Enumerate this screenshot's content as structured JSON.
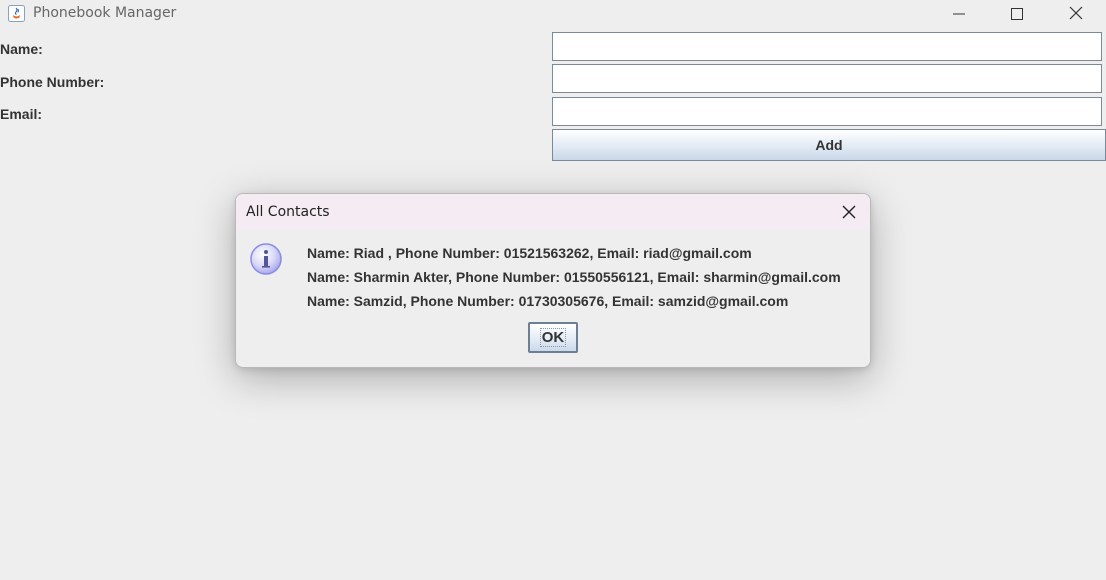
{
  "window": {
    "title": "Phonebook Manager",
    "icons": [
      "java-app-icon",
      "minimize-icon",
      "maximize-icon",
      "close-icon"
    ]
  },
  "form": {
    "name_label": "Name:",
    "phone_label": "Phone Number:",
    "email_label": "Email:",
    "name_value": "",
    "phone_value": "",
    "email_value": "",
    "add_label": "Add"
  },
  "dialog": {
    "title": "All Contacts",
    "icon": "info-icon",
    "lines": [
      "Name: Riad , Phone Number: 01521563262, Email: riad@gmail.com",
      "Name: Sharmin Akter, Phone Number: 01550556121, Email: sharmin@gmail.com",
      "Name: Samzid, Phone Number: 01730305676, Email: samzid@gmail.com"
    ],
    "ok_label": "OK"
  },
  "colors": {
    "background": "#eeeeee",
    "dialog_titlebar": "#f5ecf3",
    "button_border": "#7a8a99",
    "info_icon": "#8a8ae6"
  }
}
